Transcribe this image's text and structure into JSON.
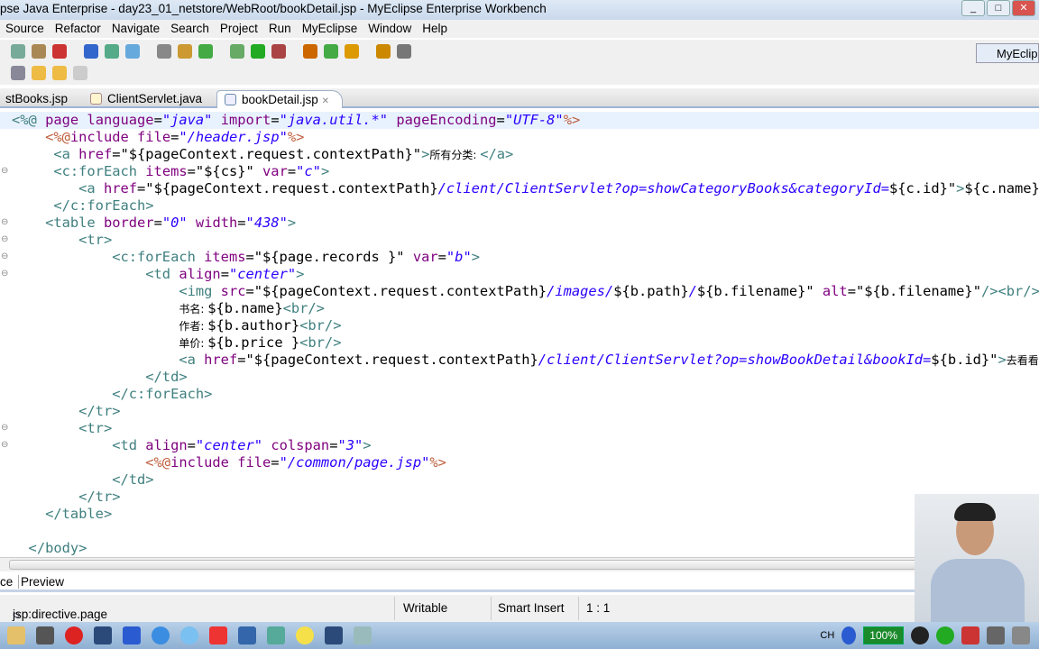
{
  "window": {
    "title": "pse Java Enterprise - day23_01_netstore/WebRoot/bookDetail.jsp - MyEclipse Enterprise Workbench",
    "controls": [
      "_",
      "□",
      "✕"
    ]
  },
  "menu": [
    "Source",
    "Refactor",
    "Navigate",
    "Search",
    "Project",
    "Run",
    "MyEclipse",
    "Window",
    "Help"
  ],
  "perspective": "MyEclip",
  "tabs": [
    {
      "label": "stBooks.jsp"
    },
    {
      "label": "ClientServlet.java"
    },
    {
      "label": "bookDetail.jsp",
      "close": "✕",
      "active": true
    }
  ],
  "code": [
    [
      [
        "t",
        "<%@ "
      ],
      [
        "a",
        "page "
      ],
      [
        "a",
        "language"
      ],
      [
        "p",
        "="
      ],
      [
        "v",
        "\"java\""
      ],
      [
        "a",
        " import"
      ],
      [
        "p",
        "="
      ],
      [
        "v",
        "\"java.util.*\""
      ],
      [
        "a",
        " pageEncoding"
      ],
      [
        "p",
        "="
      ],
      [
        "v",
        "\"UTF-8\""
      ],
      [
        "d",
        "%>"
      ]
    ],
    [
      [
        "p",
        "    "
      ],
      [
        "d",
        "<%@"
      ],
      [
        "a",
        "include "
      ],
      [
        "a",
        "file"
      ],
      [
        "p",
        "="
      ],
      [
        "v",
        "\"/header.jsp\""
      ],
      [
        "d",
        "%>"
      ]
    ],
    [
      [
        "p",
        "     "
      ],
      [
        "t",
        "<a "
      ],
      [
        "a",
        "href"
      ],
      [
        "p",
        "=\"${pageContext.request.contextPath}\""
      ],
      [
        "t",
        ">"
      ],
      [
        "x",
        "所有分类: "
      ],
      [
        "t",
        "</a>"
      ]
    ],
    [
      [
        "p",
        "     "
      ],
      [
        "t",
        "<c:forEach "
      ],
      [
        "a",
        "items"
      ],
      [
        "p",
        "=\"${cs}\" "
      ],
      [
        "a",
        "var"
      ],
      [
        "p",
        "="
      ],
      [
        "v",
        "\"c\""
      ],
      [
        "t",
        ">"
      ]
    ],
    [
      [
        "p",
        "        "
      ],
      [
        "t",
        "<a "
      ],
      [
        "a",
        "href"
      ],
      [
        "p",
        "=\"${pageContext.request.contextPath}"
      ],
      [
        "v",
        "/client/ClientServlet?op=showCategoryBooks&categoryId="
      ],
      [
        "p",
        "${c.id}\""
      ],
      [
        "t",
        ">"
      ],
      [
        "p",
        "${c.name}"
      ],
      [
        "t",
        "</a>"
      ]
    ],
    [
      [
        "p",
        "     "
      ],
      [
        "t",
        "</c:forEach>"
      ]
    ],
    [
      [
        "p",
        "    "
      ],
      [
        "t",
        "<table "
      ],
      [
        "a",
        "border"
      ],
      [
        "p",
        "="
      ],
      [
        "v",
        "\"0\""
      ],
      [
        "a",
        " width"
      ],
      [
        "p",
        "="
      ],
      [
        "v",
        "\"438\""
      ],
      [
        "t",
        ">"
      ]
    ],
    [
      [
        "p",
        "        "
      ],
      [
        "t",
        "<tr>"
      ]
    ],
    [
      [
        "p",
        "            "
      ],
      [
        "t",
        "<c:forEach "
      ],
      [
        "a",
        "items"
      ],
      [
        "p",
        "=\"${page.records }\" "
      ],
      [
        "a",
        "var"
      ],
      [
        "p",
        "="
      ],
      [
        "v",
        "\"b\""
      ],
      [
        "t",
        ">"
      ]
    ],
    [
      [
        "p",
        "                "
      ],
      [
        "t",
        "<td "
      ],
      [
        "a",
        "align"
      ],
      [
        "p",
        "="
      ],
      [
        "v",
        "\"center\""
      ],
      [
        "t",
        ">"
      ]
    ],
    [
      [
        "p",
        "                    "
      ],
      [
        "t",
        "<img "
      ],
      [
        "a",
        "src"
      ],
      [
        "p",
        "=\"${pageContext.request.contextPath}"
      ],
      [
        "v",
        "/images/"
      ],
      [
        "p",
        "${b.path}"
      ],
      [
        "v",
        "/"
      ],
      [
        "p",
        "${b.filename}\" "
      ],
      [
        "a",
        "alt"
      ],
      [
        "p",
        "=\"${b.filename}\""
      ],
      [
        "t",
        "/><br/>"
      ]
    ],
    [
      [
        "p",
        "                    "
      ],
      [
        "x",
        "书名: "
      ],
      [
        "p",
        "${b.name}"
      ],
      [
        "t",
        "<br/>"
      ]
    ],
    [
      [
        "p",
        "                    "
      ],
      [
        "x",
        "作者: "
      ],
      [
        "p",
        "${b.author}"
      ],
      [
        "t",
        "<br/>"
      ]
    ],
    [
      [
        "p",
        "                    "
      ],
      [
        "x",
        "单价: "
      ],
      [
        "p",
        "${b.price }"
      ],
      [
        "t",
        "<br/>"
      ]
    ],
    [
      [
        "p",
        "                    "
      ],
      [
        "t",
        "<a "
      ],
      [
        "a",
        "href"
      ],
      [
        "p",
        "=\"${pageContext.request.contextPath}"
      ],
      [
        "v",
        "/client/ClientServlet?op=showBookDetail&bookId="
      ],
      [
        "p",
        "${b.id}\""
      ],
      [
        "t",
        ">"
      ],
      [
        "x",
        "去看看"
      ],
      [
        "t",
        "</a>"
      ]
    ],
    [
      [
        "p",
        "                "
      ],
      [
        "t",
        "</td>"
      ]
    ],
    [
      [
        "p",
        "            "
      ],
      [
        "t",
        "</c:forEach>"
      ]
    ],
    [
      [
        "p",
        "        "
      ],
      [
        "t",
        "</tr>"
      ]
    ],
    [
      [
        "p",
        "        "
      ],
      [
        "t",
        "<tr>"
      ]
    ],
    [
      [
        "p",
        "            "
      ],
      [
        "t",
        "<td "
      ],
      [
        "a",
        "align"
      ],
      [
        "p",
        "="
      ],
      [
        "v",
        "\"center\""
      ],
      [
        "a",
        " colspan"
      ],
      [
        "p",
        "="
      ],
      [
        "v",
        "\"3\""
      ],
      [
        "t",
        ">"
      ]
    ],
    [
      [
        "p",
        "                "
      ],
      [
        "d",
        "<%@"
      ],
      [
        "a",
        "include "
      ],
      [
        "a",
        "file"
      ],
      [
        "p",
        "="
      ],
      [
        "v",
        "\"/common/page.jsp\""
      ],
      [
        "d",
        "%>"
      ]
    ],
    [
      [
        "p",
        "            "
      ],
      [
        "t",
        "</td>"
      ]
    ],
    [
      [
        "p",
        "        "
      ],
      [
        "t",
        "</tr>"
      ]
    ],
    [
      [
        "p",
        "    "
      ],
      [
        "t",
        "</table>"
      ]
    ],
    [
      [
        "p",
        ""
      ]
    ],
    [
      [
        "p",
        "  "
      ],
      [
        "t",
        "</body>"
      ]
    ]
  ],
  "fold_lines": [
    3,
    6,
    7,
    8,
    9,
    18,
    19
  ],
  "source_tabs": [
    "ce",
    "Preview"
  ],
  "status": {
    "node": "jsp:directive.page",
    "mode": "Writable",
    "insert": "Smart Insert",
    "position": "1 : 1"
  },
  "tray": {
    "lang": "CH",
    "battery": "100%"
  }
}
